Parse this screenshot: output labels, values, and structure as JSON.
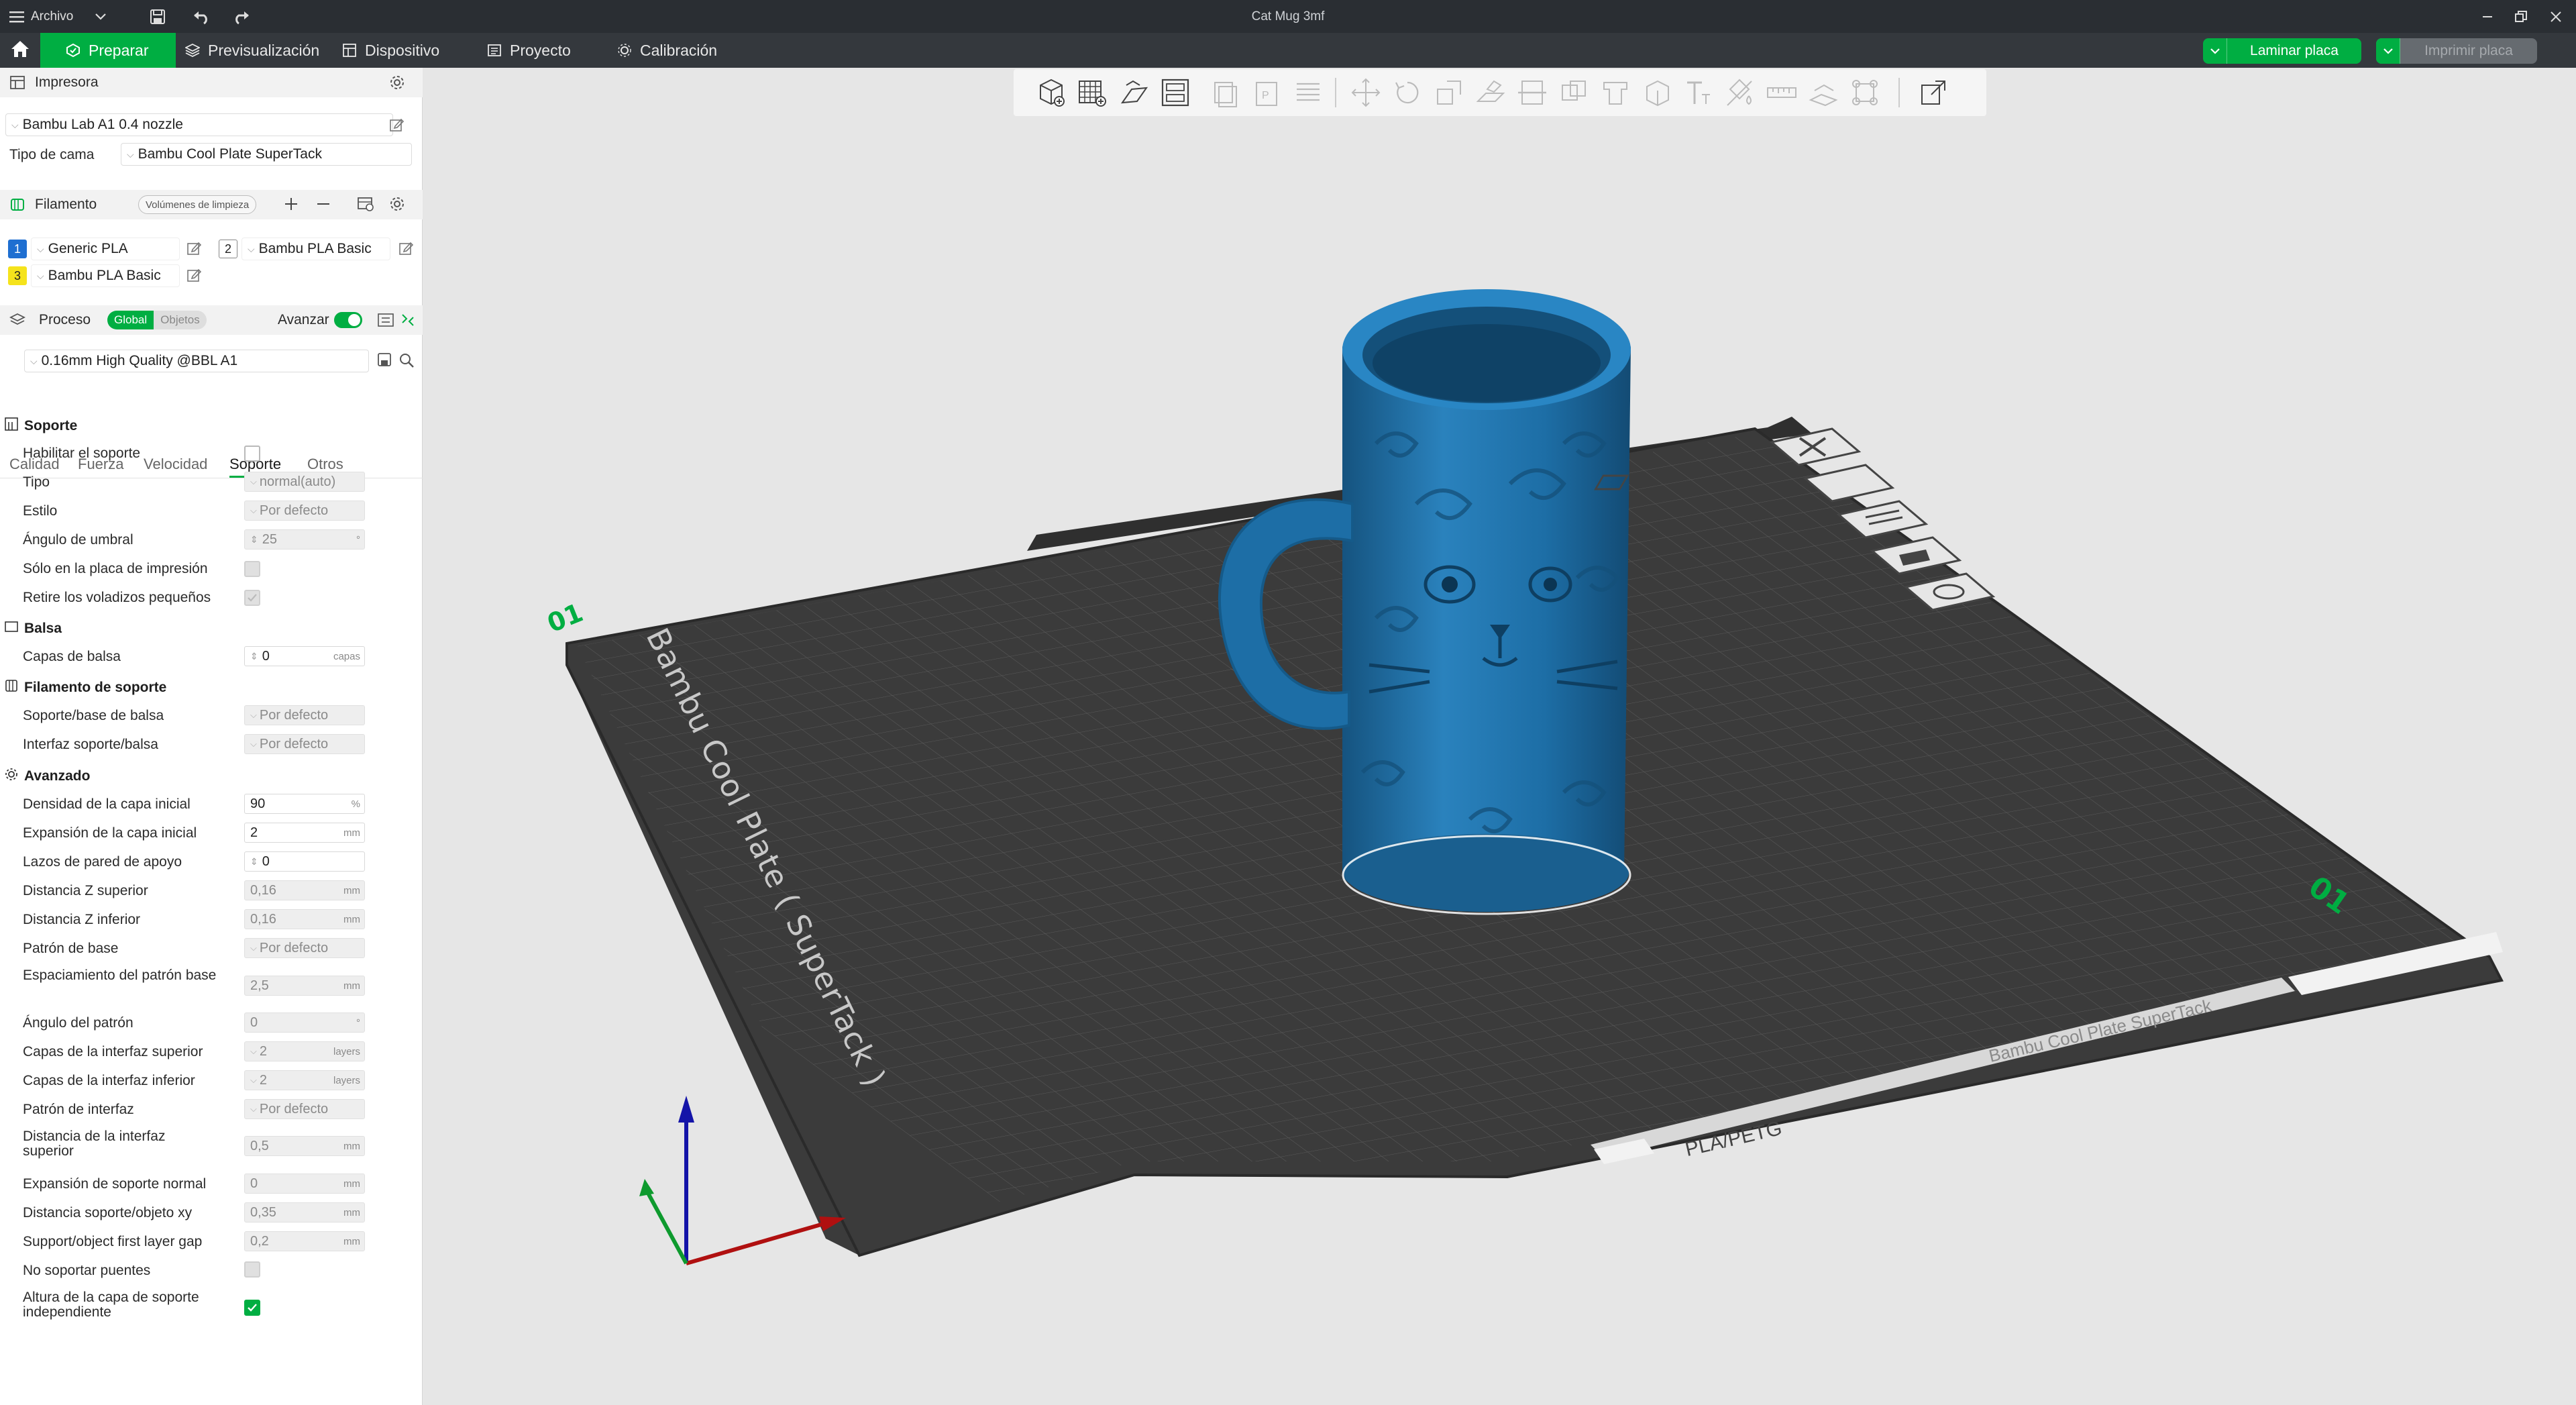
{
  "titlebar": {
    "menu_label": "Archivo",
    "document_title": "Cat Mug 3mf"
  },
  "nav": {
    "tabs": [
      {
        "label": "Preparar",
        "active": true
      },
      {
        "label": "Previsualización",
        "active": false
      },
      {
        "label": "Dispositivo",
        "active": false
      },
      {
        "label": "Proyecto",
        "active": false
      },
      {
        "label": "Calibración",
        "active": false
      }
    ],
    "slice_button": "Laminar placa",
    "print_button": "Imprimir placa"
  },
  "printer": {
    "section_title": "Impresora",
    "printer_name": "Bambu Lab A1 0.4 nozzle",
    "bed_type_label": "Tipo de cama",
    "bed_type_value": "Bambu Cool Plate SuperTack"
  },
  "filament": {
    "section_title": "Filamento",
    "flush_button": "Volúmenes de limpieza",
    "slots": [
      {
        "num": "1",
        "name": "Generic PLA",
        "color": "#1f6fd1",
        "text_color": "#ffffff"
      },
      {
        "num": "2",
        "name": "Bambu PLA Basic",
        "color": "#ffffff",
        "text_color": "#222222"
      },
      {
        "num": "3",
        "name": "Bambu PLA Basic",
        "color": "#f5e31c",
        "text_color": "#222222"
      }
    ]
  },
  "process": {
    "section_title": "Proceso",
    "toggle_global": "Global",
    "toggle_objects": "Objetos",
    "advanced_label": "Avanzar",
    "preset": "0.16mm High Quality @BBL A1",
    "tabs": [
      "Calidad",
      "Fuerza",
      "Velocidad",
      "Soporte",
      "Otros"
    ],
    "active_tab": "Soporte"
  },
  "support": {
    "group_soporte": "Soporte",
    "enable_support_label": "Habilitar el soporte",
    "type_label": "Tipo",
    "type_value": "normal(auto)",
    "style_label": "Estilo",
    "style_value": "Por defecto",
    "threshold_label": "Ángulo de umbral",
    "threshold_value": "25",
    "threshold_unit": "°",
    "on_plate_label": "Sólo en la placa de impresión",
    "remove_small_label": "Retire los voladizos pequeños",
    "group_raft": "Balsa",
    "raft_layers_label": "Capas de balsa",
    "raft_layers_value": "0",
    "raft_layers_unit": "capas",
    "group_filament": "Filamento de soporte",
    "base_raft_label": "Soporte/base de balsa",
    "base_raft_value": "Por defecto",
    "interface_raft_label": "Interfaz soporte/balsa",
    "interface_raft_value": "Por defecto",
    "group_advanced": "Avanzado",
    "rows": [
      {
        "label": "Densidad de la capa inicial",
        "value": "90",
        "unit": "%",
        "kind": "input"
      },
      {
        "label": "Expansión de la capa inicial",
        "value": "2",
        "unit": "mm",
        "kind": "input"
      },
      {
        "label": "Lazos de pared de apoyo",
        "value": "0",
        "unit": "",
        "kind": "spin"
      },
      {
        "label": "Distancia Z superior",
        "value": "0,16",
        "unit": "mm",
        "kind": "disabled"
      },
      {
        "label": "Distancia Z inferior",
        "value": "0,16",
        "unit": "mm",
        "kind": "disabled"
      },
      {
        "label": "Patrón de base",
        "value": "Por defecto",
        "unit": "",
        "kind": "combo"
      },
      {
        "label": "Espaciamiento del patrón base",
        "value": "2,5",
        "unit": "mm",
        "kind": "disabled"
      },
      {
        "label": "Ángulo del patrón",
        "value": "0",
        "unit": "°",
        "kind": "disabled"
      },
      {
        "label": "Capas de la interfaz superior",
        "value": "2",
        "unit": "layers",
        "kind": "combo-unit"
      },
      {
        "label": "Capas de la interfaz inferior",
        "value": "2",
        "unit": "layers",
        "kind": "combo-unit"
      },
      {
        "label": "Patrón de interfaz",
        "value": "Por defecto",
        "unit": "",
        "kind": "combo"
      },
      {
        "label": "Distancia de la interfaz superior",
        "value": "0,5",
        "unit": "mm",
        "kind": "disabled"
      },
      {
        "label": "Expansión de soporte normal",
        "value": "0",
        "unit": "mm",
        "kind": "disabled"
      },
      {
        "label": "Distancia soporte/objeto xy",
        "value": "0,35",
        "unit": "mm",
        "kind": "disabled"
      },
      {
        "label": "Support/object first layer gap",
        "value": "0,2",
        "unit": "mm",
        "kind": "disabled"
      },
      {
        "label": "No soportar puentes",
        "value": "",
        "unit": "",
        "kind": "checkbox-disabled"
      },
      {
        "label": "Altura de la capa de soporte independiente",
        "value": "",
        "unit": "",
        "kind": "checkbox-checked"
      }
    ]
  },
  "viewport": {
    "plate_name": "Bambu Cool Plate ( SuperTack )",
    "plate_label_front": "Bambu Cool Plate   SuperTack",
    "plate_material": "PLA/PETG",
    "plate_number_left": "01",
    "plate_number_right": "01",
    "model_color": "#1f6fa3",
    "bed_color": "#3c3c3c",
    "accent": "#00ae42"
  }
}
